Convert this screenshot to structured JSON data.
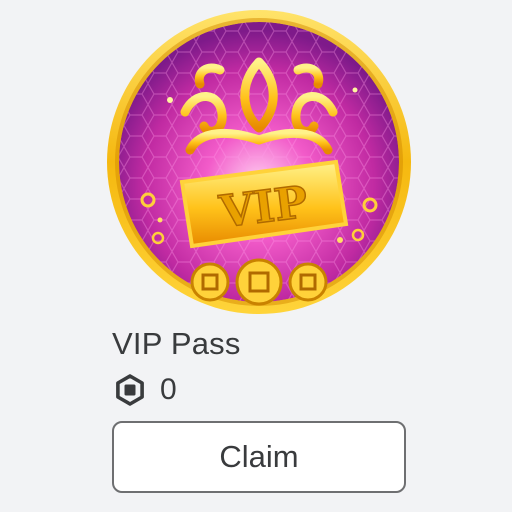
{
  "item": {
    "thumbnail_icon": "vip-crown-badge-icon",
    "badge_text": "VIP",
    "name": "VIP Pass",
    "price_icon": "robux-icon",
    "price": "0",
    "claim_label": "Claim"
  },
  "colors": {
    "background": "#f2f3f5",
    "text": "#393b3d",
    "button_border": "#6e6f71",
    "gold": "#f6c21c",
    "pink": "#e03fb6"
  }
}
